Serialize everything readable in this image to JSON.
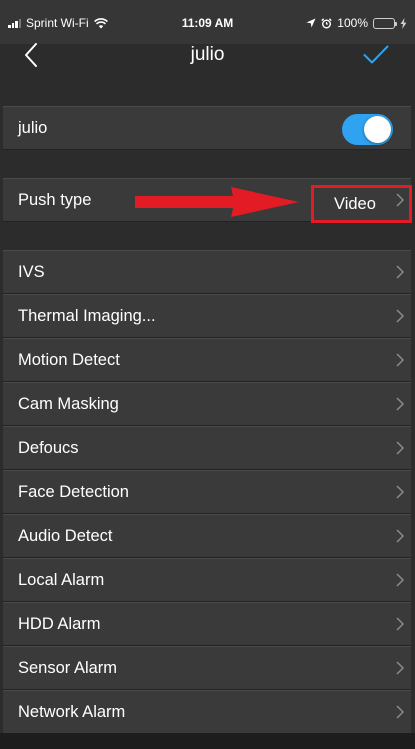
{
  "status_bar": {
    "carrier": "Sprint Wi-Fi",
    "time": "11:09 AM",
    "battery": "100%"
  },
  "nav": {
    "title": "julio"
  },
  "device_row": {
    "label": "julio",
    "toggle_on": true
  },
  "push_row": {
    "label": "Push type",
    "value": "Video"
  },
  "menu_items": [
    "IVS",
    "Thermal Imaging...",
    "Motion Detect",
    "Cam Masking",
    "Defoucs",
    "Face Detection",
    "Audio Detect",
    "Local Alarm",
    "HDD Alarm",
    "Sensor Alarm",
    "Network Alarm"
  ],
  "colors": {
    "accent": "#2fa3f0",
    "annotation": "#e21b24",
    "battery": "#4cd964"
  }
}
